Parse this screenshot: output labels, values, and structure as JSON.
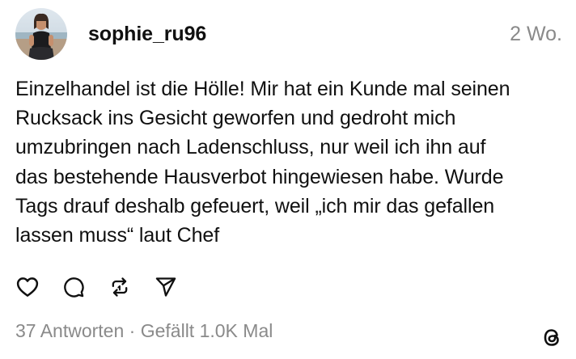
{
  "post": {
    "username": "sophie_ru96",
    "timestamp": "2 Wo.",
    "text": "Einzelhandel ist die Hölle! Mir hat ein Kunde mal seinen\nRucksack ins Gesicht geworfen und gedroht mich\numzubringen nach Ladenschluss, nur weil ich ihn auf\ndas bestehende Hausverbot hingewiesen habe. Wurde\nTags drauf deshalb gefeuert, weil „ich mir das gefallen\nlassen muss“ laut Chef",
    "replies": "37 Antworten",
    "separator": " · ",
    "likes": "Gefällt 1.0K Mal"
  },
  "icons": {
    "like": "heart-icon",
    "comment": "speech-bubble-icon",
    "repost": "repost-icon",
    "share": "paper-plane-icon",
    "brand": "threads-logo-icon"
  },
  "colors": {
    "text": "#101010",
    "muted": "#8a8a8a",
    "background": "#ffffff"
  }
}
